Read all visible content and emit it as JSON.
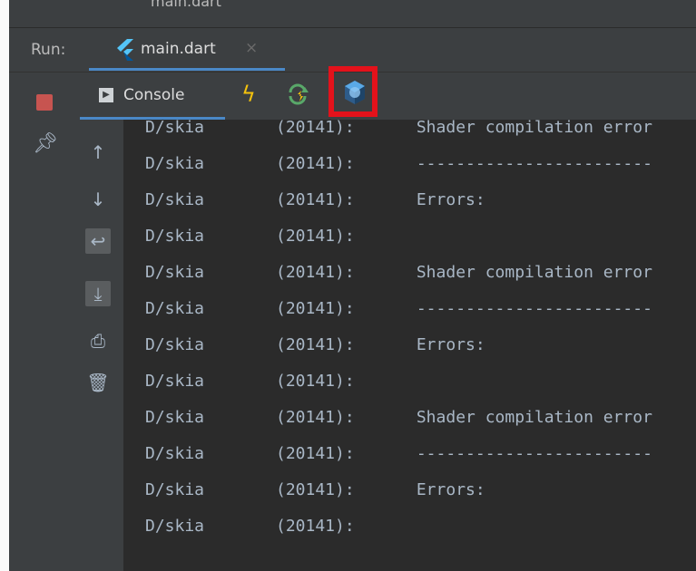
{
  "header": {
    "cut_text": "main.dart"
  },
  "run_bar": {
    "label": "Run:",
    "tab": {
      "title": "main.dart",
      "close": "×"
    }
  },
  "console_tab": {
    "label": "Console"
  },
  "icons": {
    "stop": "stop-icon",
    "pin": "pin-icon",
    "console": "console-icon",
    "hot_reload": "lightning-icon",
    "hot_restart": "restart-icon",
    "devtools": "flutter-devtools-icon",
    "scroll_up": "arrow-up-icon",
    "scroll_down": "arrow-down-icon",
    "soft_wrap": "soft-wrap-icon",
    "scroll_to_end": "scroll-to-end-icon",
    "print": "print-icon",
    "clear": "trash-icon"
  },
  "colors": {
    "highlight": "#e3121b",
    "accent": "#4a88c7",
    "stop": "#c75450",
    "bolt": "#f4c20d"
  },
  "log": [
    {
      "tag": "D/skia",
      "pid": "(20141):",
      "msg": "Shader compilation error"
    },
    {
      "tag": "D/skia",
      "pid": "(20141):",
      "msg": "------------------------"
    },
    {
      "tag": "D/skia",
      "pid": "(20141):",
      "msg": "Errors:"
    },
    {
      "tag": "D/skia",
      "pid": "(20141):",
      "msg": ""
    },
    {
      "tag": "D/skia",
      "pid": "(20141):",
      "msg": "Shader compilation error"
    },
    {
      "tag": "D/skia",
      "pid": "(20141):",
      "msg": "------------------------"
    },
    {
      "tag": "D/skia",
      "pid": "(20141):",
      "msg": "Errors:"
    },
    {
      "tag": "D/skia",
      "pid": "(20141):",
      "msg": ""
    },
    {
      "tag": "D/skia",
      "pid": "(20141):",
      "msg": "Shader compilation error"
    },
    {
      "tag": "D/skia",
      "pid": "(20141):",
      "msg": "------------------------"
    },
    {
      "tag": "D/skia",
      "pid": "(20141):",
      "msg": "Errors:"
    },
    {
      "tag": "D/skia",
      "pid": "(20141):",
      "msg": ""
    }
  ]
}
